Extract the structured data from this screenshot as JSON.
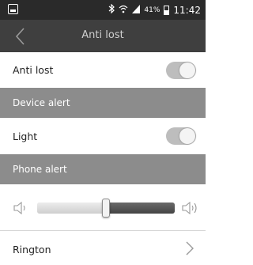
{
  "status_bar": {
    "battery_percent": "41%",
    "time": "11:42",
    "icons": [
      "screenshot-icon",
      "bluetooth-icon",
      "wifi-icon",
      "signal-icon",
      "battery-icon"
    ]
  },
  "app_bar": {
    "title": "Anti lost",
    "back_icon": "chevron-left-icon"
  },
  "settings": {
    "anti_lost": {
      "label": "Anti lost",
      "toggle_on": true
    },
    "device_alert_header": "Device alert",
    "light": {
      "label": "Light",
      "toggle_on": true
    },
    "phone_alert_header": "Phone alert",
    "volume": {
      "level": 0.5,
      "min_icon": "speaker-low-icon",
      "max_icon": "speaker-high-icon"
    },
    "ringtone": {
      "label": "Rington",
      "icon": "chevron-right-icon"
    }
  },
  "colors": {
    "status_bar": "#2a2a2a",
    "app_bar": "#3f3f3f",
    "section_header": "#8c8c8c",
    "toggle_track": "#bdbdbd"
  }
}
